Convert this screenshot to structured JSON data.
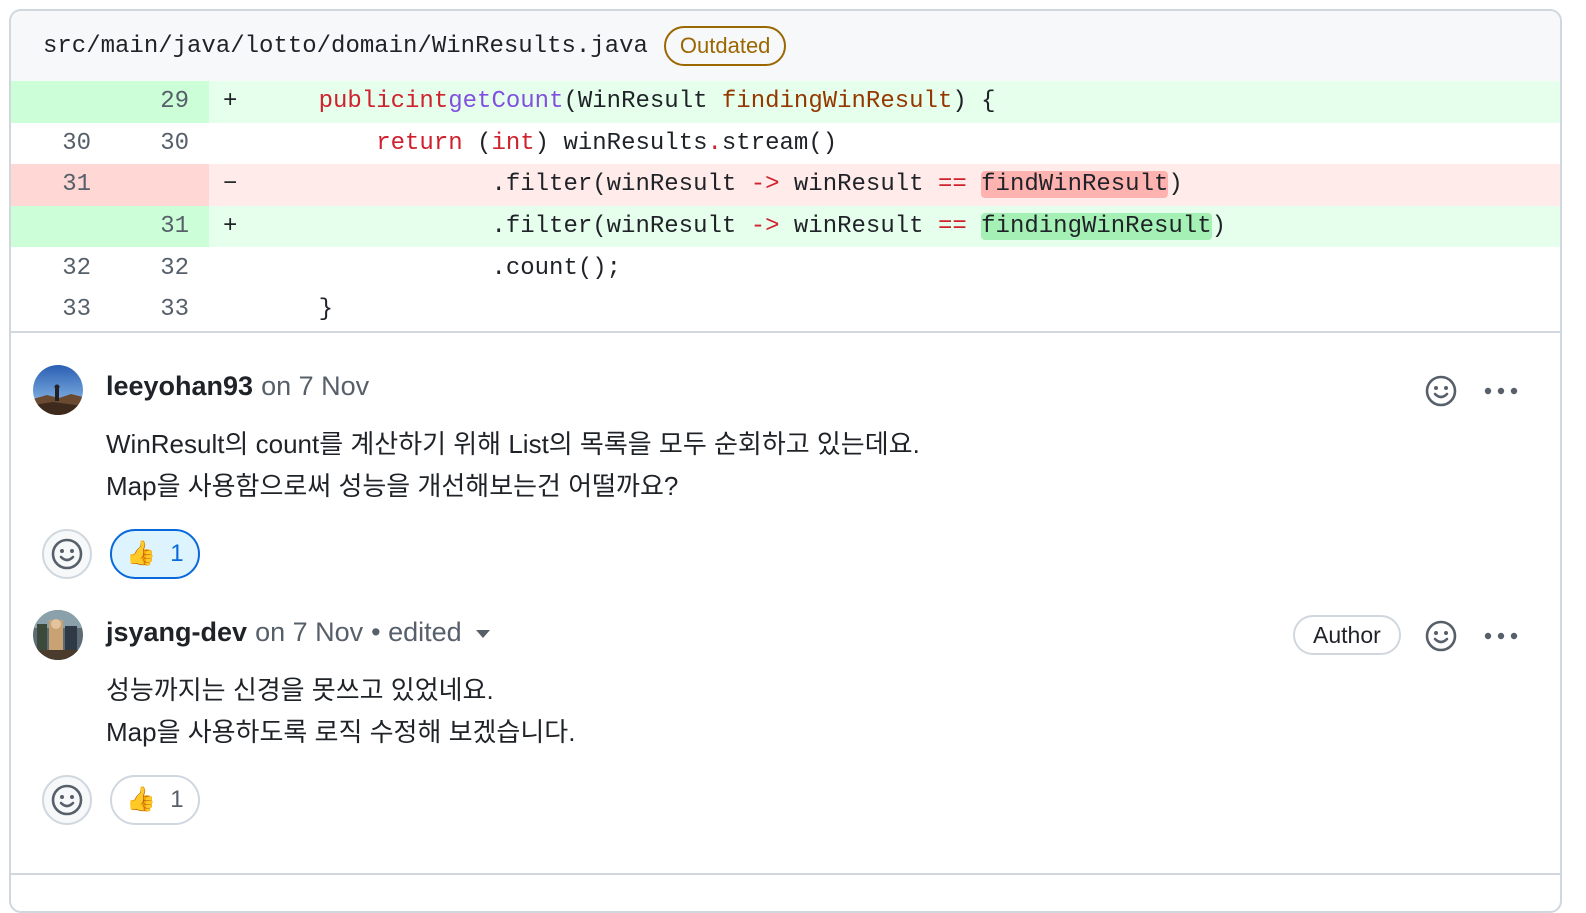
{
  "file": {
    "path": "src/main/java/lotto/domain/WinResults.java",
    "badge": "Outdated"
  },
  "diff": [
    {
      "type": "add",
      "old": "",
      "new": "29",
      "marker": "+"
    },
    {
      "type": "ctx",
      "old": "30",
      "new": "30",
      "marker": ""
    },
    {
      "type": "del",
      "old": "31",
      "new": "",
      "marker": "−"
    },
    {
      "type": "add",
      "old": "",
      "new": "31",
      "marker": "+"
    },
    {
      "type": "ctx",
      "old": "32",
      "new": "32",
      "marker": ""
    },
    {
      "type": "ctx",
      "old": "33",
      "new": "33",
      "marker": ""
    }
  ],
  "code": {
    "l1": {
      "indent": "    ",
      "kw1": "public",
      "kw2": "int",
      "fn": "getCount",
      "open": "(WinResult ",
      "param": "findingWinResult",
      "close": ") {"
    },
    "l2": {
      "indent": "        ",
      "kw": "return",
      "mid": " (",
      "kw2": "int",
      "rest": ") winResults",
      "dot": ".",
      "tail": "stream()"
    },
    "l3": {
      "indent": "                ",
      "pre": ".filter(winResult ",
      "arrow": "->",
      "mid": " winResult ",
      "eq": "==",
      "sp": " ",
      "hl": "findWinResult",
      "tail": ")"
    },
    "l4": {
      "indent": "                ",
      "pre": ".filter(winResult ",
      "arrow": "->",
      "mid": " winResult ",
      "eq": "==",
      "sp": " ",
      "hl": "findingWinResult",
      "tail": ")"
    },
    "l5": {
      "indent": "                ",
      "text": ".count();"
    },
    "l6": {
      "indent": "    ",
      "text": "}"
    }
  },
  "comments": [
    {
      "author": "leeyohan93",
      "meta": "on 7 Nov",
      "body": [
        "WinResult의 count를 계산하기 위해 List의 목록을 모두 순회하고 있는데요.",
        "Map을 사용함으로써 성능을 개선해보는건 어떨까요?"
      ],
      "reaction_count": "1"
    },
    {
      "author": "jsyang-dev",
      "meta": "on 7 Nov",
      "edited": "• edited",
      "badge": "Author",
      "body": [
        "성능까지는 신경을 못쓰고 있었네요.",
        "Map을 사용하도록 로직 수정해 보겠습니다."
      ],
      "reaction_count": "1"
    }
  ],
  "icons": {
    "smiley": "smiley-icon",
    "more": "kebab-horizontal-icon",
    "thumbsup": "thumbs-up-icon",
    "caret": "triangle-down-icon"
  },
  "colors": {
    "outdated": "#9a6700",
    "add_bg": "#e6ffec",
    "del_bg": "#ffebe9",
    "reaction_active": "#0969da"
  }
}
